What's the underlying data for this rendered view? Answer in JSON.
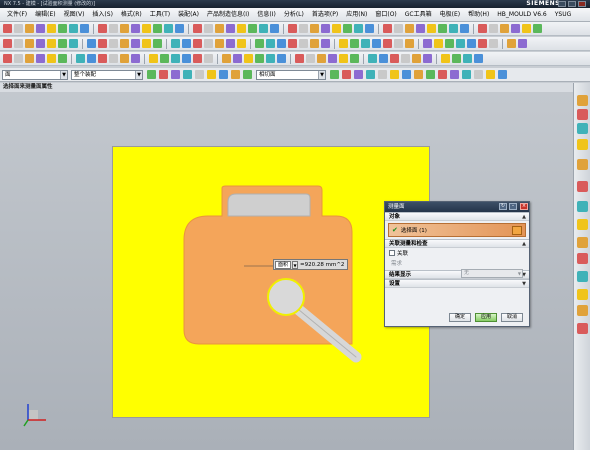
{
  "window": {
    "title": "NX 7.5 - 建模 - [试验面积测量 (修改的)]",
    "brand": "SIEMENS"
  },
  "menu": {
    "items": [
      "文件(F)",
      "编辑(E)",
      "视图(V)",
      "插入(S)",
      "格式(R)",
      "工具(T)",
      "装配(A)",
      "产品制造信息(I)",
      "信息(I)",
      "分析(L)",
      "首选项(P)",
      "应用(N)",
      "窗口(O)",
      "GC工具箱",
      "电极(E)",
      "帮助(H)",
      "HB_MOULD V6.6",
      "YSUG"
    ]
  },
  "filter": {
    "selection_type": "面",
    "assembly_scope": "整个装配",
    "snap_mode": "相切面"
  },
  "cue": "选择面来测量面属性",
  "measurement": {
    "mode": "面积",
    "value": "=920.28 mm^2"
  },
  "dialog": {
    "title": "测量面",
    "groups": {
      "object": "对象",
      "assoc": "关联测量和检查",
      "results": "结果显示",
      "settings": "设置"
    },
    "select_faces": "选择面 (1)",
    "associative_label": "关联",
    "requirement_label": "需求",
    "requirement_value": "无",
    "buttons": {
      "ok": "确定",
      "apply": "应用",
      "cancel": "取消"
    }
  },
  "colors": {
    "background_yellow": "#ffff00",
    "part_orange": "#f4a55a",
    "dialog_title": "#2c3e55",
    "selection_highlight": "#e39456"
  }
}
